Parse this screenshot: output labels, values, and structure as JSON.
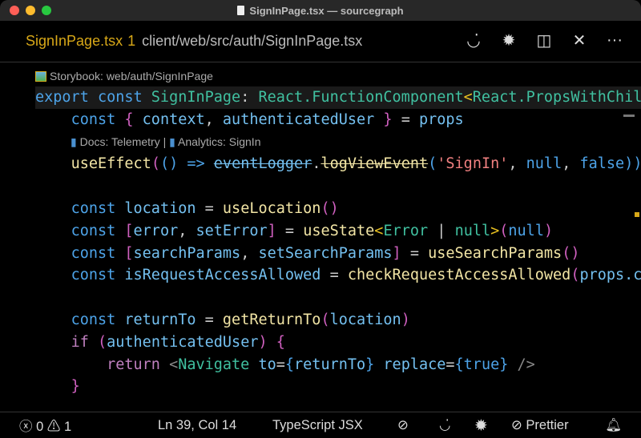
{
  "window": {
    "title": "SignInPage.tsx — sourcegraph"
  },
  "tab": {
    "name": "SignInPage.tsx",
    "problem_count": "1",
    "path": "client/web/src/auth/SignInPage.tsx"
  },
  "tab_actions": [
    {
      "icon": "smile-icon",
      "glyph": "◡̇"
    },
    {
      "icon": "sourcegraph-badge-icon",
      "glyph": "✹"
    },
    {
      "icon": "split-editor-icon",
      "glyph": "◫"
    },
    {
      "icon": "close-icon",
      "glyph": "✕"
    },
    {
      "icon": "more-icon",
      "glyph": "···"
    }
  ],
  "codelens": {
    "storybook": "Storybook: web/auth/SignInPage",
    "docs": "Docs: Telemetry | ",
    "analytics": "Analytics: SignIn"
  },
  "code": [
    [
      [
        "k",
        "export "
      ],
      [
        "k",
        "const "
      ],
      [
        "t",
        "SignInPage"
      ],
      [
        "o",
        ": "
      ],
      [
        "t",
        "React.FunctionComponent"
      ],
      [
        "y",
        "<"
      ],
      [
        "t",
        "React.PropsWithChil"
      ]
    ],
    [
      [
        "o",
        "    "
      ],
      [
        "k",
        "const "
      ],
      [
        "p",
        "{ "
      ],
      [
        "v",
        "context"
      ],
      [
        "o",
        ", "
      ],
      [
        "v",
        "authenticatedUser"
      ],
      [
        "p",
        " }"
      ],
      [
        "o",
        " = "
      ],
      [
        "v",
        "props"
      ]
    ],
    null,
    [
      [
        "o",
        "    "
      ],
      [
        "f",
        "useEffect"
      ],
      [
        "p",
        "("
      ],
      [
        "k",
        "()"
      ],
      [
        "o",
        " "
      ],
      [
        "k",
        "=>"
      ],
      [
        "o",
        " "
      ],
      [
        "v strike",
        "eventLogger"
      ],
      [
        "o",
        "."
      ],
      [
        "f strike",
        "logViewEvent"
      ],
      [
        "k",
        "("
      ],
      [
        "s",
        "'SignIn'"
      ],
      [
        "o",
        ", "
      ],
      [
        "k",
        "null"
      ],
      [
        "o",
        ", "
      ],
      [
        "k",
        "false"
      ],
      [
        "k",
        "))"
      ]
    ],
    [],
    [
      [
        "o",
        "    "
      ],
      [
        "k",
        "const "
      ],
      [
        "v",
        "location"
      ],
      [
        "o",
        " = "
      ],
      [
        "f",
        "useLocation"
      ],
      [
        "p",
        "()"
      ]
    ],
    [
      [
        "o",
        "    "
      ],
      [
        "k",
        "const "
      ],
      [
        "p",
        "["
      ],
      [
        "v",
        "error"
      ],
      [
        "o",
        ", "
      ],
      [
        "v",
        "setError"
      ],
      [
        "p",
        "]"
      ],
      [
        "o",
        " = "
      ],
      [
        "f",
        "useState"
      ],
      [
        "y",
        "<"
      ],
      [
        "t",
        "Error"
      ],
      [
        "o",
        " | "
      ],
      [
        "t",
        "null"
      ],
      [
        "y",
        ">"
      ],
      [
        "p",
        "("
      ],
      [
        "k",
        "null"
      ],
      [
        "p",
        ")"
      ]
    ],
    [
      [
        "o",
        "    "
      ],
      [
        "k",
        "const "
      ],
      [
        "p",
        "["
      ],
      [
        "v",
        "searchParams"
      ],
      [
        "o",
        ", "
      ],
      [
        "v",
        "setSearchParams"
      ],
      [
        "p",
        "]"
      ],
      [
        "o",
        " = "
      ],
      [
        "f",
        "useSearchParams"
      ],
      [
        "p",
        "()"
      ]
    ],
    [
      [
        "o",
        "    "
      ],
      [
        "k",
        "const "
      ],
      [
        "v",
        "isRequestAccessAllowed"
      ],
      [
        "o",
        " = "
      ],
      [
        "f",
        "checkRequestAccessAllowed"
      ],
      [
        "p",
        "("
      ],
      [
        "v",
        "props.c"
      ]
    ],
    [],
    [
      [
        "o",
        "    "
      ],
      [
        "k",
        "const "
      ],
      [
        "v",
        "returnTo"
      ],
      [
        "o",
        " = "
      ],
      [
        "f",
        "getReturnTo"
      ],
      [
        "p",
        "("
      ],
      [
        "v",
        "location"
      ],
      [
        "p",
        ")"
      ]
    ],
    [
      [
        "o",
        "    "
      ],
      [
        "m",
        "if "
      ],
      [
        "p",
        "("
      ],
      [
        "v",
        "authenticatedUser"
      ],
      [
        "p",
        ")"
      ],
      [
        "o",
        " "
      ],
      [
        "p",
        "{"
      ]
    ],
    [
      [
        "o",
        "        "
      ],
      [
        "m",
        "return "
      ],
      [
        "g",
        "<"
      ],
      [
        "t",
        "Navigate"
      ],
      [
        "o",
        " "
      ],
      [
        "v",
        "to"
      ],
      [
        "o",
        "="
      ],
      [
        "k",
        "{"
      ],
      [
        "v",
        "returnTo"
      ],
      [
        "k",
        "}"
      ],
      [
        "o",
        " "
      ],
      [
        "v",
        "replace"
      ],
      [
        "o",
        "="
      ],
      [
        "k",
        "{"
      ],
      [
        "k",
        "true"
      ],
      [
        "k",
        "}"
      ],
      [
        "g",
        " />"
      ]
    ],
    [
      [
        "o",
        "    "
      ],
      [
        "p",
        "}"
      ]
    ]
  ],
  "status": {
    "errors": "0",
    "warnings": "1",
    "position": "Ln 39, Col 14",
    "language": "TypeScript JSX",
    "prettier": "Prettier"
  }
}
